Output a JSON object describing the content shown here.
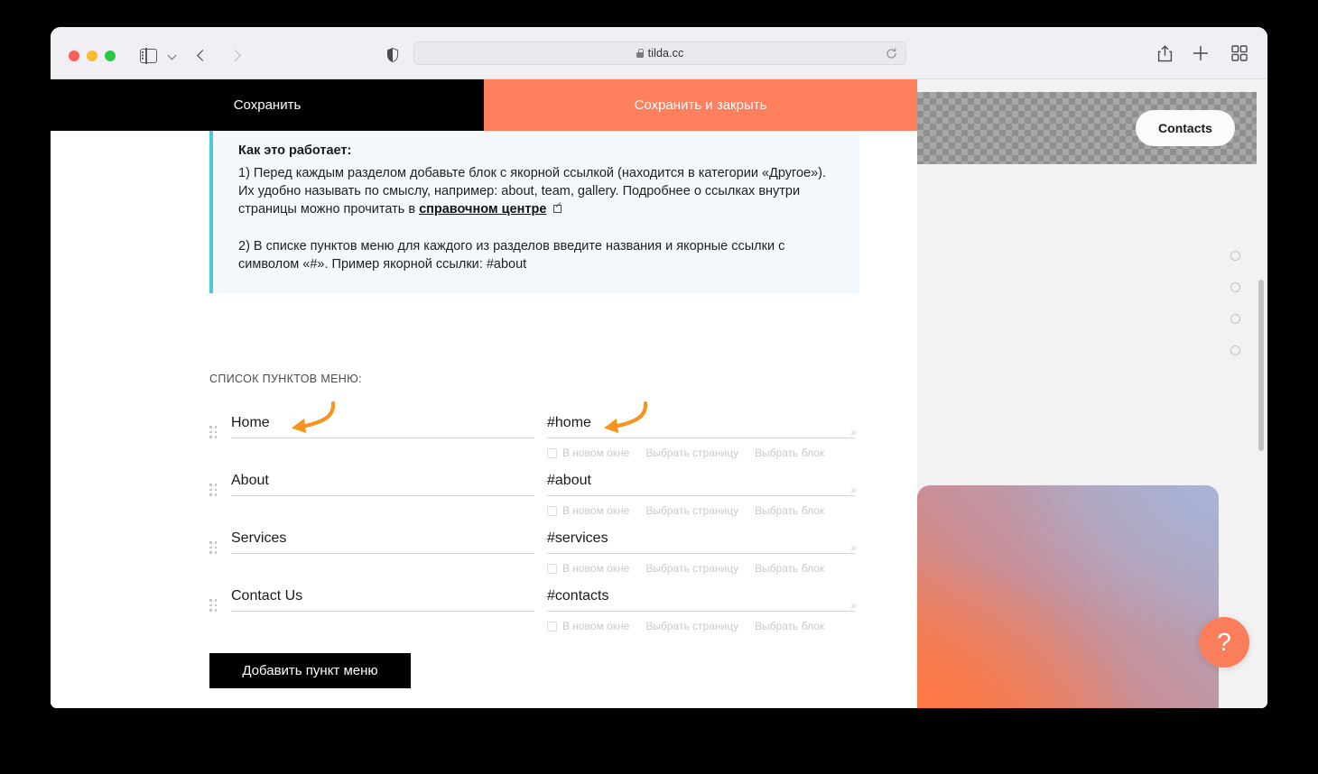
{
  "browser": {
    "url": "tilda.cc",
    "icons": {
      "sidebar": "sidebar-toggle-icon",
      "chevron": "chevron-down-icon",
      "back": "back-arrow-icon",
      "forward": "forward-arrow-icon",
      "shield": "shield-privacy-icon",
      "lock": "lock-icon",
      "reload": "reload-icon",
      "share": "share-icon",
      "plus": "new-tab-icon",
      "tabs": "tab-overview-icon"
    }
  },
  "editor": {
    "save_label": "Сохранить",
    "save_close_label": "Сохранить и закрыть",
    "info": {
      "title": "Как это работает:",
      "para1_before": "1) Перед каждым разделом добавьте блок с якорной ссылкой (находится в категории «Другое»). Их удобно называть по смыслу, например: about, team, gallery. Подробнее о ссылках внутри страницы можно прочитать в ",
      "link_text": "справочном центре",
      "para2": "2) В списке пунктов меню для каждого из разделов введите названия и якорные ссылки с символом «#». Пример якорной ссылки: #about"
    },
    "list_header": "СПИСОК ПУНКТОВ МЕНЮ:",
    "options": {
      "new_window": "В новом окне",
      "choose_page": "Выбрать страницу",
      "choose_block": "Выбрать блок"
    },
    "delete_symbol": "×",
    "title_placeholder": "",
    "link_placeholder": "",
    "add_button_label": "Добавить пункт меню",
    "rows": [
      {
        "title": "Home",
        "link": "#home"
      },
      {
        "title": "About",
        "link": "#about"
      },
      {
        "title": "Services",
        "link": "#services"
      },
      {
        "title": "Contact Us",
        "link": "#contacts"
      }
    ]
  },
  "preview": {
    "contacts_label": "Contacts",
    "help_label": "?",
    "dots_count": 4
  },
  "colors": {
    "accent_orange": "#fd7f5e",
    "info_border": "#4fc8df",
    "info_bg": "#f2f8fc",
    "black": "#000000",
    "help_orange": "#fa7e5c"
  }
}
